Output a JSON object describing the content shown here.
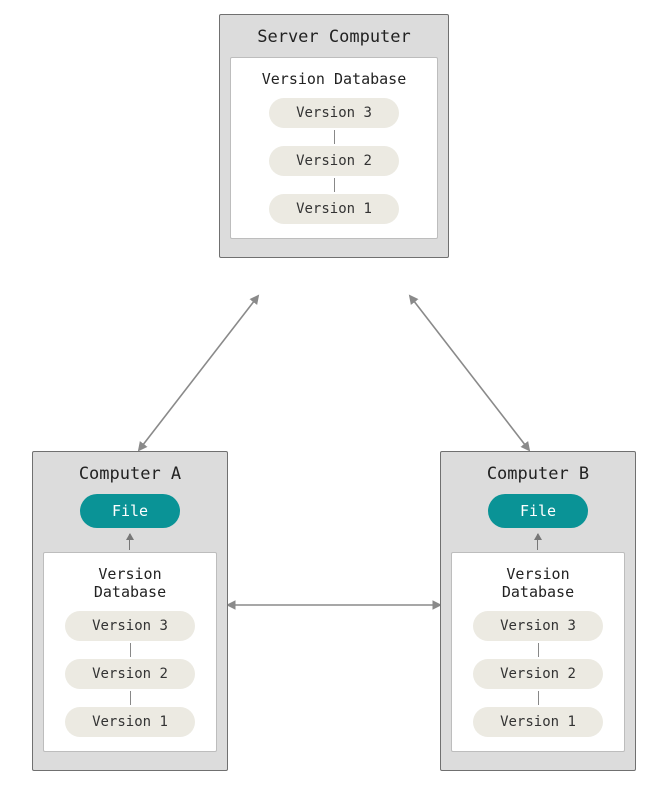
{
  "server": {
    "title": "Server Computer",
    "vdb_title": "Version Database",
    "versions": [
      "Version 3",
      "Version 2",
      "Version 1"
    ]
  },
  "computer_a": {
    "title": "Computer A",
    "file_label": "File",
    "vdb_title": "Version Database",
    "versions": [
      "Version 3",
      "Version 2",
      "Version 1"
    ]
  },
  "computer_b": {
    "title": "Computer B",
    "file_label": "File",
    "vdb_title": "Version Database",
    "versions": [
      "Version 3",
      "Version 2",
      "Version 1"
    ]
  }
}
